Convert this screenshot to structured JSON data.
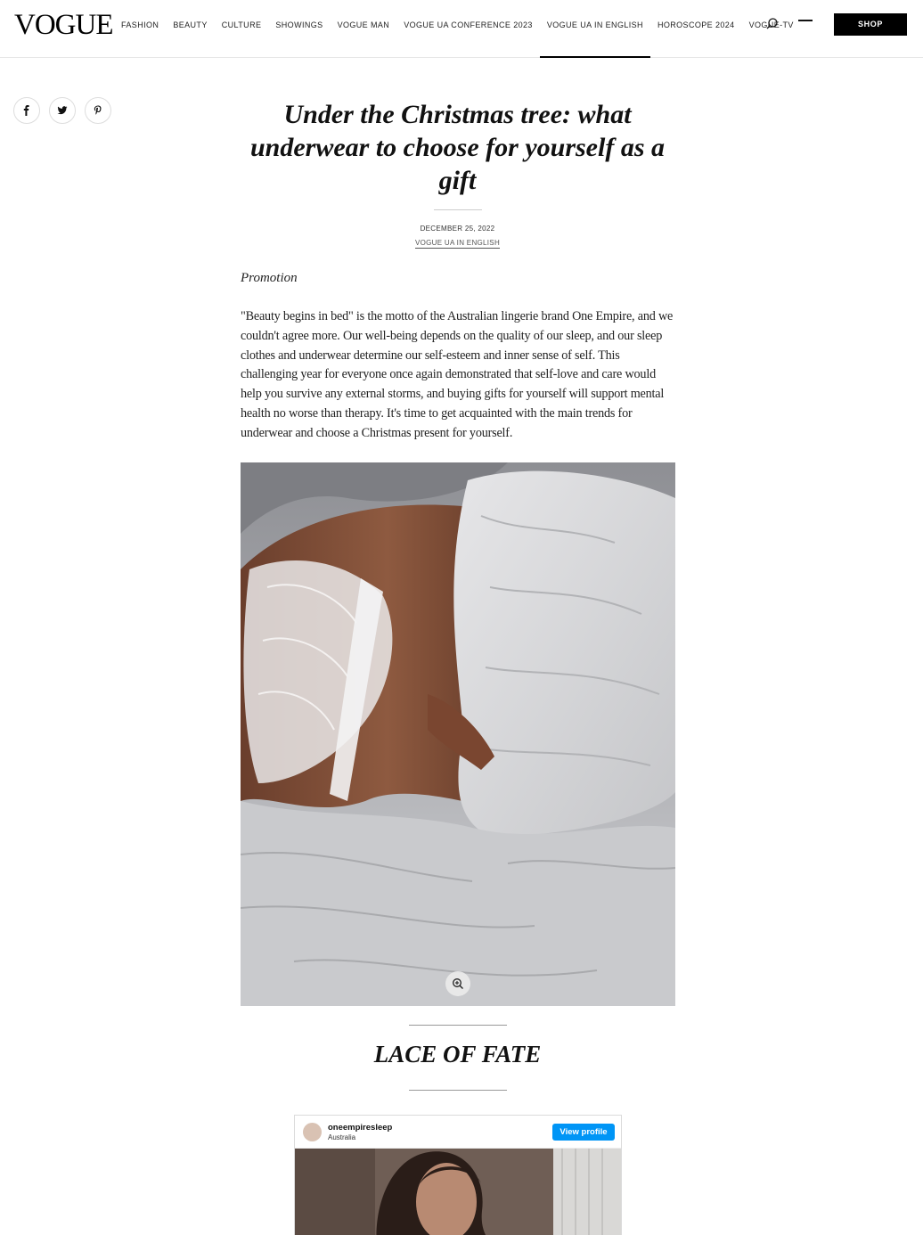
{
  "header": {
    "logo": "VOGUE",
    "nav": [
      {
        "label": "FASHION"
      },
      {
        "label": "BEAUTY"
      },
      {
        "label": "CULTURE"
      },
      {
        "label": "SHOWINGS"
      },
      {
        "label": "VOGUE MAN"
      },
      {
        "label": "VOGUE UA CONFERENCE 2023"
      },
      {
        "label": "VOGUE UA IN ENGLISH",
        "active": true
      },
      {
        "label": "HOROSCOPE 2024"
      },
      {
        "label": "VOGUE-TV"
      }
    ],
    "shop_label": "SHOP"
  },
  "share": {
    "icons": [
      "facebook-icon",
      "twitter-icon",
      "pinterest-icon"
    ]
  },
  "article": {
    "title": "Under the Christmas tree: what underwear to choose for yourself as a gift",
    "date": "DECEMBER 25, 2022",
    "category": "VOGUE UA IN ENGLISH",
    "promo": "Promotion",
    "body": "\"Beauty begins in bed\" is the motto of the Australian lingerie brand One Empire, and we couldn't agree more. Our well-being depends on the quality of our sleep, and our sleep clothes and underwear determine our self-esteem and inner sense of self. This challenging year for everyone once again demonstrated that self-love and care would help you survive any external storms, and buying gifts for yourself will support mental health no worse than therapy. It's time to get acquainted with the main trends for underwear and choose a Christmas present for yourself.",
    "section_title": "LACE OF FATE"
  },
  "instagram": {
    "username": "oneempiresleep",
    "location": "Australia",
    "view_label": "View profile"
  },
  "colors": {
    "accent": "#000000",
    "ig_blue": "#0095f6"
  }
}
